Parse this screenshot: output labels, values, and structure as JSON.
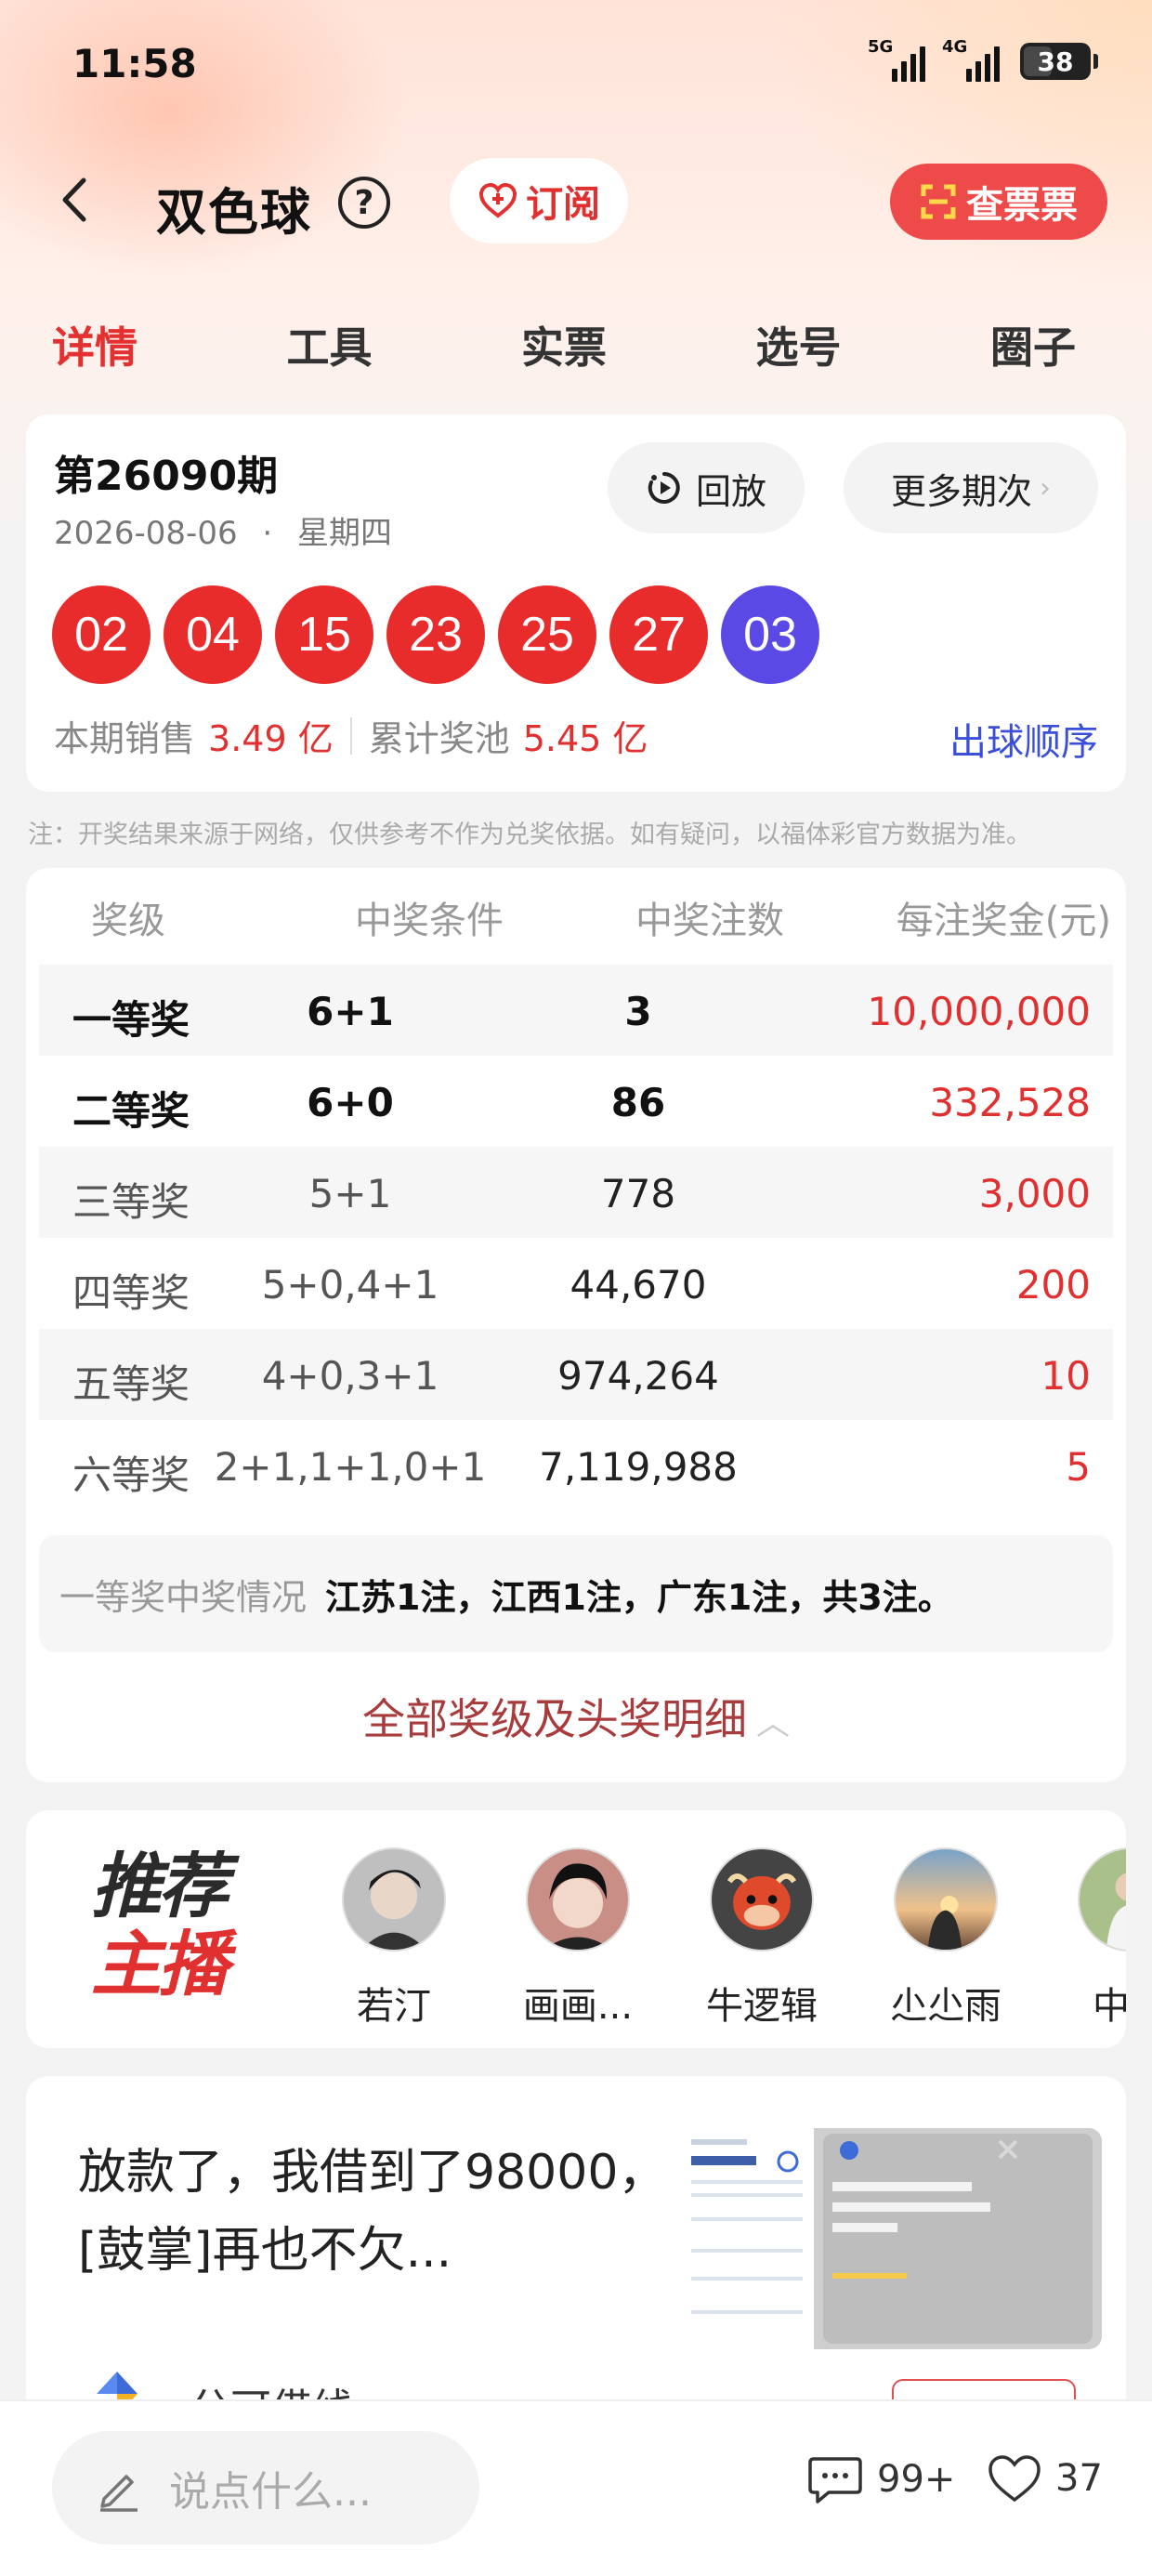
{
  "status_bar": {
    "time": "11:58",
    "signal1_label": "5G",
    "signal2_label": "4G",
    "battery": "38"
  },
  "header": {
    "title": "双色球",
    "help": "?",
    "subscribe_label": "订阅",
    "check_ticket_label": "查票票"
  },
  "tabs": [
    {
      "label": "详情",
      "active": true
    },
    {
      "label": "工具",
      "active": false
    },
    {
      "label": "实票",
      "active": false
    },
    {
      "label": "选号",
      "active": false
    },
    {
      "label": "圈子",
      "active": false
    }
  ],
  "draw": {
    "period": "第26090期",
    "date": "2026-08-06",
    "dot": "·",
    "weekday": "星期四",
    "replay_label": "回放",
    "more_label": "更多期次",
    "red_balls": [
      "02",
      "04",
      "15",
      "23",
      "25",
      "27"
    ],
    "blue_ball": "03",
    "sales_label": "本期销售",
    "sales_value": "3.49 亿",
    "pool_label": "累计奖池",
    "pool_value": "5.45 亿",
    "order_link": "出球顺序"
  },
  "note": "注：开奖结果来源于网络，仅供参考不作为兑奖依据。如有疑问，以福体彩官方数据为准。",
  "prize_table": {
    "headers": [
      "奖级",
      "中奖条件",
      "中奖注数",
      "每注奖金(元)"
    ],
    "rows": [
      {
        "level": "一等奖",
        "condition": "6+1",
        "count": "3",
        "amount": "10,000,000"
      },
      {
        "level": "二等奖",
        "condition": "6+0",
        "count": "86",
        "amount": "332,528"
      },
      {
        "level": "三等奖",
        "condition": "5+1",
        "count": "778",
        "amount": "3,000"
      },
      {
        "level": "四等奖",
        "condition": "5+0,4+1",
        "count": "44,670",
        "amount": "200"
      },
      {
        "level": "五等奖",
        "condition": "4+0,3+1",
        "count": "974,264",
        "amount": "10"
      },
      {
        "level": "六等奖",
        "condition": "2+1,1+1,0+1",
        "count": "7,119,988",
        "amount": "5"
      }
    ],
    "first_prize_label": "一等奖中奖情况",
    "first_prize_detail": "江苏1注，江西1注，广东1注，共3注。",
    "all_levels_label": "全部奖级及头奖明细"
  },
  "anchors": {
    "logo_line1": "推荐",
    "logo_line2": "主播",
    "items": [
      {
        "name": "若汀"
      },
      {
        "name": "画画..."
      },
      {
        "name": "牛逻辑"
      },
      {
        "name": "尐尐雨"
      },
      {
        "name": "中奖"
      }
    ]
  },
  "post": {
    "text": "放款了，我借到了98000，[鼓掌]再也不欠...",
    "author": "分可借线"
  },
  "bottom_bar": {
    "comment_placeholder": "说点什么...",
    "comment_count": "99+",
    "like_count": "37"
  },
  "colors": {
    "accent_red": "#e33030",
    "red_ball": "#e82c2c",
    "blue_ball": "#5b49e6",
    "link_blue": "#3b4fd8"
  }
}
